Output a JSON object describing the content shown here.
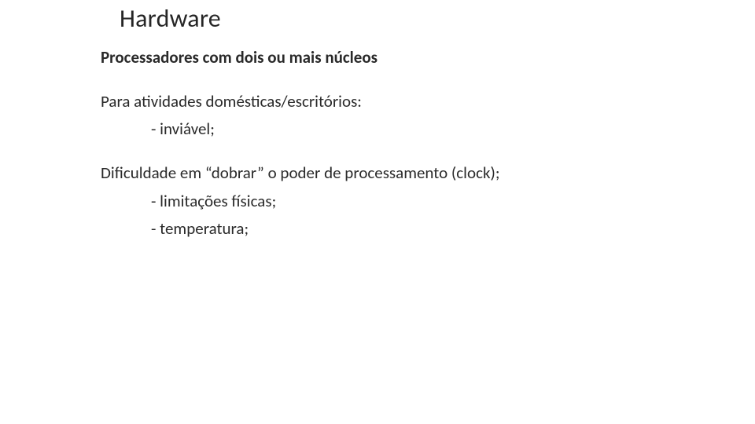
{
  "title": "Hardware",
  "subhead": "Processadores com dois ou mais núcleos",
  "sec1_lead": "Para atividades domésticas/escritórios:",
  "sec1_b1": "- inviável;",
  "sec2_lead": "Dificuldade em “dobrar” o poder de processamento (clock);",
  "sec2_b1": "- limitações físicas;",
  "sec2_b2": "- temperatura;"
}
